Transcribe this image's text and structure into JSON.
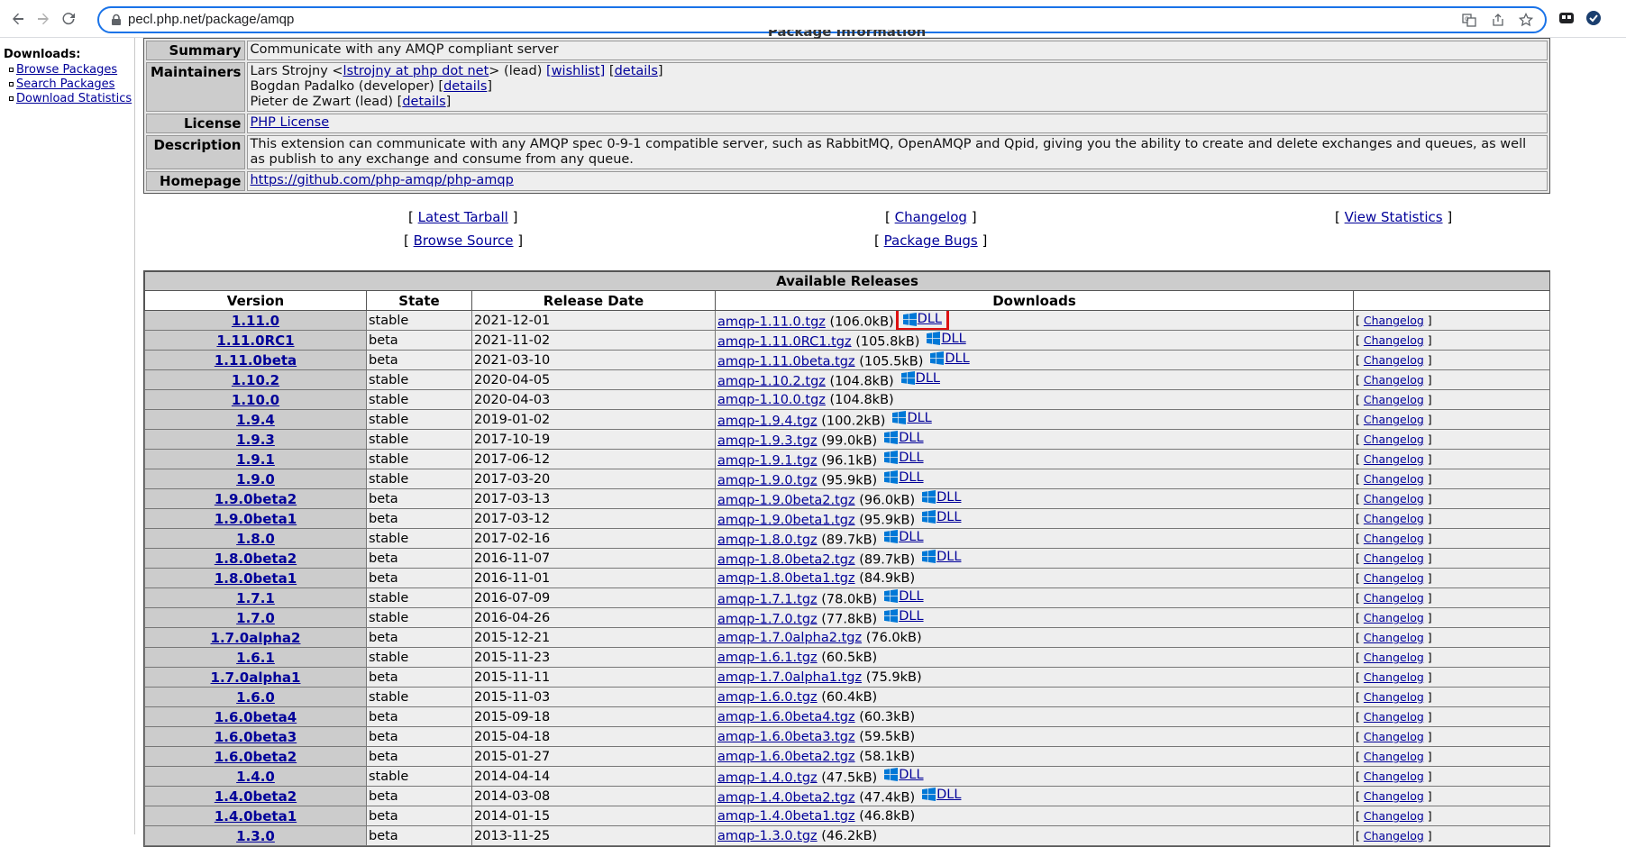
{
  "browser": {
    "url": "pecl.php.net/package/amqp"
  },
  "sidebar": {
    "heading": "Downloads:",
    "items": [
      {
        "label": "Browse Packages"
      },
      {
        "label": "Search Packages"
      },
      {
        "label": "Download Statistics"
      }
    ]
  },
  "package_info": {
    "title": "Package Information",
    "summary_label": "Summary",
    "summary": "Communicate with any AMQP compliant server",
    "maintainers_label": "Maintainers",
    "maintainer1_name": "Lars Strojny <",
    "maintainer1_email": "lstrojny at php dot net",
    "maintainer1_role": "> (lead)",
    "wishlist_label": "[wishlist]",
    "maintainer2": "Bogdan Padalko (developer)",
    "maintainer3": "Pieter de Zwart (lead)",
    "details_label": "details",
    "license_label": "License",
    "license": "PHP License",
    "description_label": "Description",
    "description": "This extension can communicate with any AMQP spec 0-9-1 compatible server, such as RabbitMQ, OpenAMQP and Qpid, giving you the ability to create and delete exchanges and queues, as well as publish to any exchange and consume from any queue.",
    "homepage_label": "Homepage",
    "homepage": "https://github.com/php-amqp/php-amqp"
  },
  "actions": {
    "latest_tarball": "Latest Tarball",
    "changelog": "Changelog",
    "view_statistics": "View Statistics",
    "browse_source": "Browse Source",
    "package_bugs": "Package Bugs"
  },
  "releases": {
    "caption": "Available Releases",
    "headers": {
      "version": "Version",
      "state": "State",
      "date": "Release Date",
      "downloads": "Downloads"
    },
    "dll_label": "DLL",
    "changelog_label": "Changelog",
    "rows": [
      {
        "version": "1.11.0",
        "state": "stable",
        "date": "2021-12-01",
        "file": "amqp-1.11.0.tgz",
        "size": "(106.0kB)",
        "dll": true
      },
      {
        "version": "1.11.0RC1",
        "state": "beta",
        "date": "2021-11-02",
        "file": "amqp-1.11.0RC1.tgz",
        "size": "(105.8kB)",
        "dll": true
      },
      {
        "version": "1.11.0beta",
        "state": "beta",
        "date": "2021-03-10",
        "file": "amqp-1.11.0beta.tgz",
        "size": "(105.5kB)",
        "dll": true
      },
      {
        "version": "1.10.2",
        "state": "stable",
        "date": "2020-04-05",
        "file": "amqp-1.10.2.tgz",
        "size": "(104.8kB)",
        "dll": true
      },
      {
        "version": "1.10.0",
        "state": "stable",
        "date": "2020-04-03",
        "file": "amqp-1.10.0.tgz",
        "size": "(104.8kB)",
        "dll": false
      },
      {
        "version": "1.9.4",
        "state": "stable",
        "date": "2019-01-02",
        "file": "amqp-1.9.4.tgz",
        "size": "(100.2kB)",
        "dll": true
      },
      {
        "version": "1.9.3",
        "state": "stable",
        "date": "2017-10-19",
        "file": "amqp-1.9.3.tgz",
        "size": "(99.0kB)",
        "dll": true
      },
      {
        "version": "1.9.1",
        "state": "stable",
        "date": "2017-06-12",
        "file": "amqp-1.9.1.tgz",
        "size": "(96.1kB)",
        "dll": true
      },
      {
        "version": "1.9.0",
        "state": "stable",
        "date": "2017-03-20",
        "file": "amqp-1.9.0.tgz",
        "size": "(95.9kB)",
        "dll": true
      },
      {
        "version": "1.9.0beta2",
        "state": "beta",
        "date": "2017-03-13",
        "file": "amqp-1.9.0beta2.tgz",
        "size": "(96.0kB)",
        "dll": true
      },
      {
        "version": "1.9.0beta1",
        "state": "beta",
        "date": "2017-03-12",
        "file": "amqp-1.9.0beta1.tgz",
        "size": "(95.9kB)",
        "dll": true
      },
      {
        "version": "1.8.0",
        "state": "stable",
        "date": "2017-02-16",
        "file": "amqp-1.8.0.tgz",
        "size": "(89.7kB)",
        "dll": true
      },
      {
        "version": "1.8.0beta2",
        "state": "beta",
        "date": "2016-11-07",
        "file": "amqp-1.8.0beta2.tgz",
        "size": "(89.7kB)",
        "dll": true
      },
      {
        "version": "1.8.0beta1",
        "state": "beta",
        "date": "2016-11-01",
        "file": "amqp-1.8.0beta1.tgz",
        "size": "(84.9kB)",
        "dll": false
      },
      {
        "version": "1.7.1",
        "state": "stable",
        "date": "2016-07-09",
        "file": "amqp-1.7.1.tgz",
        "size": "(78.0kB)",
        "dll": true
      },
      {
        "version": "1.7.0",
        "state": "stable",
        "date": "2016-04-26",
        "file": "amqp-1.7.0.tgz",
        "size": "(77.8kB)",
        "dll": true
      },
      {
        "version": "1.7.0alpha2",
        "state": "beta",
        "date": "2015-12-21",
        "file": "amqp-1.7.0alpha2.tgz",
        "size": "(76.0kB)",
        "dll": false
      },
      {
        "version": "1.6.1",
        "state": "stable",
        "date": "2015-11-23",
        "file": "amqp-1.6.1.tgz",
        "size": "(60.5kB)",
        "dll": false
      },
      {
        "version": "1.7.0alpha1",
        "state": "beta",
        "date": "2015-11-11",
        "file": "amqp-1.7.0alpha1.tgz",
        "size": "(75.9kB)",
        "dll": false
      },
      {
        "version": "1.6.0",
        "state": "stable",
        "date": "2015-11-03",
        "file": "amqp-1.6.0.tgz",
        "size": "(60.4kB)",
        "dll": false
      },
      {
        "version": "1.6.0beta4",
        "state": "beta",
        "date": "2015-09-18",
        "file": "amqp-1.6.0beta4.tgz",
        "size": "(60.3kB)",
        "dll": false
      },
      {
        "version": "1.6.0beta3",
        "state": "beta",
        "date": "2015-04-18",
        "file": "amqp-1.6.0beta3.tgz",
        "size": "(59.5kB)",
        "dll": false
      },
      {
        "version": "1.6.0beta2",
        "state": "beta",
        "date": "2015-01-27",
        "file": "amqp-1.6.0beta2.tgz",
        "size": "(58.1kB)",
        "dll": false
      },
      {
        "version": "1.4.0",
        "state": "stable",
        "date": "2014-04-14",
        "file": "amqp-1.4.0.tgz",
        "size": "(47.5kB)",
        "dll": true
      },
      {
        "version": "1.4.0beta2",
        "state": "beta",
        "date": "2014-03-08",
        "file": "amqp-1.4.0beta2.tgz",
        "size": "(47.4kB)",
        "dll": true
      },
      {
        "version": "1.4.0beta1",
        "state": "beta",
        "date": "2014-01-15",
        "file": "amqp-1.4.0beta1.tgz",
        "size": "(46.8kB)",
        "dll": false
      },
      {
        "version": "1.3.0",
        "state": "beta",
        "date": "2013-11-25",
        "file": "amqp-1.3.0.tgz",
        "size": "(46.2kB)",
        "dll": false
      }
    ]
  },
  "colors": {
    "link": "#000099",
    "header_bg": "#cccccc",
    "cell_bg": "#eeeeee",
    "highlight": "#dd1111",
    "windows_blue": "#0078d7"
  }
}
